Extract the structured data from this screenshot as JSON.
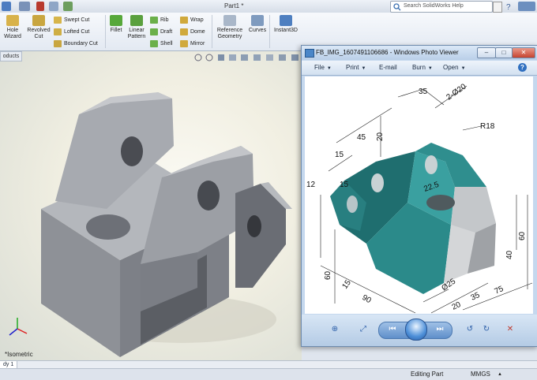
{
  "app": {
    "document_title": "Part1 *",
    "search_placeholder": "Search SolidWorks Help"
  },
  "ribbon": {
    "hole_wizard": [
      "Hole",
      "Wizard"
    ],
    "revolved_cut": [
      "Revolved",
      "Cut"
    ],
    "swept_cut": "Swept Cut",
    "lofted_cut": "Lofted Cut",
    "boundary_cut": "Boundary Cut",
    "fillet": "Fillet",
    "linear_pattern": [
      "Linear",
      "Pattern"
    ],
    "rib": "Rib",
    "draft": "Draft",
    "shell": "Shell",
    "wrap": "Wrap",
    "dome": "Dome",
    "mirror": "Mirror",
    "reference_geometry": [
      "Reference",
      "Geometry"
    ],
    "curves": "Curves",
    "instant3d": "Instant3D"
  },
  "left_panel": {
    "products_tab": "oducts"
  },
  "viewport": {
    "view_label": "*Isometric",
    "axis_x": "X",
    "axis_y": "Y",
    "axis_z": "Z"
  },
  "tabs": {
    "model": "dy 1"
  },
  "status": {
    "editing": "Editing Part",
    "units": "MMGS"
  },
  "photo_viewer": {
    "title": "FB_IMG_1607491106686 - Windows Photo Viewer",
    "menu": [
      "File",
      "Print",
      "E-mail",
      "Burn",
      "Open"
    ],
    "help": "?"
  },
  "drawing_dims": {
    "d35": "35",
    "d2phi20": "2-Ø20",
    "d45": "45",
    "r18": "R18",
    "d15a": "15",
    "d20": "20",
    "d15b": "15",
    "d12": "12",
    "d22": "22.5",
    "d60a": "60",
    "d40": "40",
    "d60b": "60",
    "d15c": "15",
    "d25": "Ø25",
    "d90": "90",
    "d20b": "20",
    "d35b": "35",
    "d75": "75"
  },
  "colors": {
    "part_teal": "#2b8a8a",
    "part_grey": "#c9ccd0",
    "solid_grey": "#8a8d93"
  }
}
